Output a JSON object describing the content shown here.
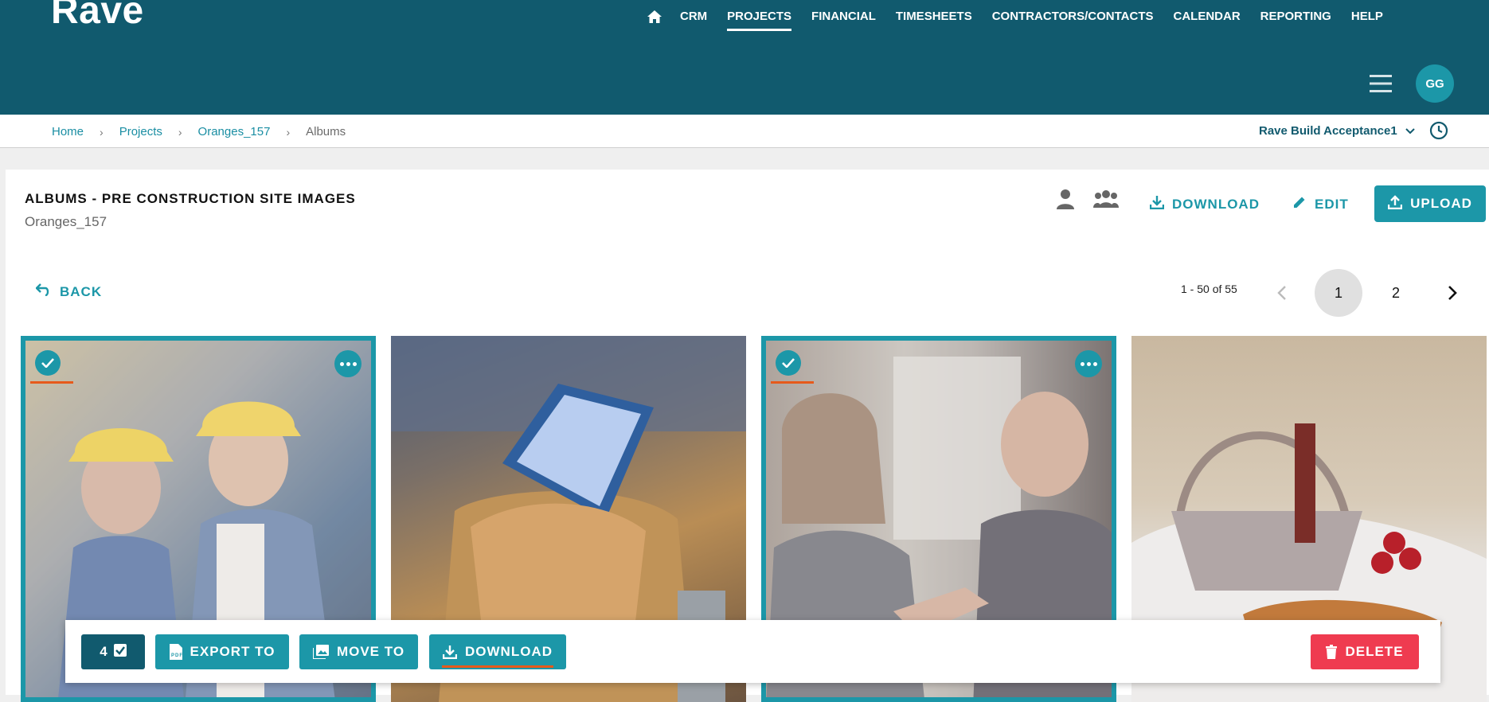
{
  "app": {
    "logo": "Rave"
  },
  "nav": {
    "items": [
      {
        "label": "CRM",
        "active": false
      },
      {
        "label": "PROJECTS",
        "active": true
      },
      {
        "label": "FINANCIAL",
        "active": false
      },
      {
        "label": "TIMESHEETS",
        "active": false
      },
      {
        "label": "CONTRACTORS/CONTACTS",
        "active": false
      },
      {
        "label": "CALENDAR",
        "active": false
      },
      {
        "label": "REPORTING",
        "active": false
      },
      {
        "label": "HELP",
        "active": false
      }
    ],
    "icons": {
      "home": "home-icon",
      "menu": "hamburger-menu-icon"
    },
    "avatar_initials": "GG"
  },
  "breadcrumb": {
    "items": [
      "Home",
      "Projects",
      "Oranges_157",
      "Albums"
    ],
    "project_selector": "Rave Build Acceptance1"
  },
  "album": {
    "title": "ALBUMS - PRE CONSTRUCTION SITE IMAGES",
    "subtitle": "Oranges_157",
    "download_label": "DOWNLOAD",
    "edit_label": "EDIT",
    "upload_label": "UPLOAD",
    "back_label": "BACK"
  },
  "pagination": {
    "range": "1 - 50 of 55",
    "pages": [
      "1",
      "2"
    ],
    "current": "1"
  },
  "photos": [
    {
      "subject": "construction workers with hard hats",
      "selected": true
    },
    {
      "subject": "tablet in tool belt",
      "selected": false
    },
    {
      "subject": "business handshake",
      "selected": true
    },
    {
      "subject": "picnic basket on beach",
      "selected": false
    }
  ],
  "action_bar": {
    "selected_count": "4",
    "export_label": "EXPORT TO",
    "move_label": "MOVE TO",
    "download_label": "DOWNLOAD",
    "delete_label": "DELETE"
  },
  "colors": {
    "header": "#115a6e",
    "accent": "#1c97a8",
    "danger": "#ef3b50",
    "highlight": "#e65a1b"
  }
}
